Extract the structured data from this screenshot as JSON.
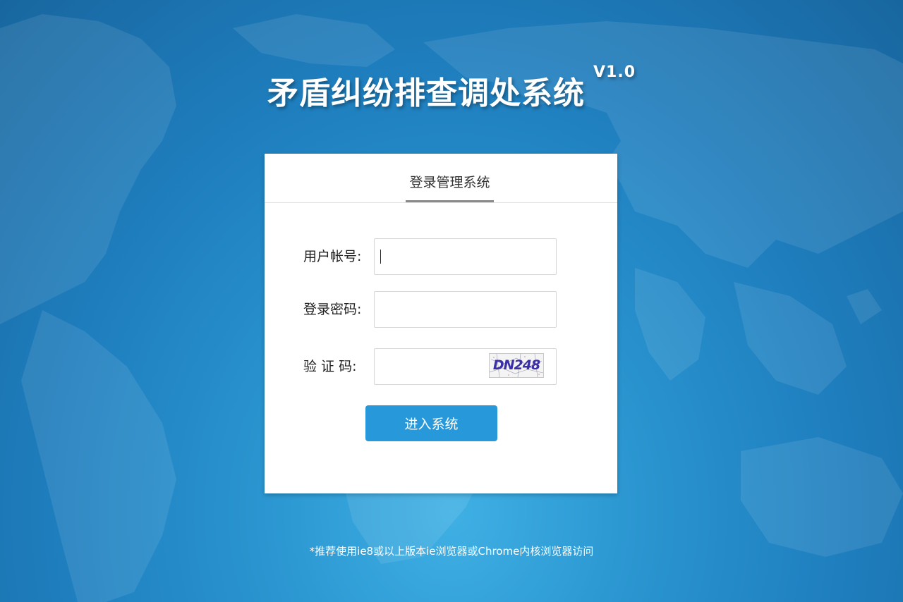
{
  "header": {
    "title": "矛盾纠纷排查调处系统",
    "version": "V1.0"
  },
  "login": {
    "tab_label": "登录管理系统",
    "username_label": "用户帐号:",
    "username_value": "",
    "password_label": "登录密码:",
    "password_value": "",
    "captcha_label": "验 证 码:",
    "captcha_value": "",
    "captcha_image_text": "DN248",
    "submit_label": "进入系统"
  },
  "footer": {
    "note": "*推荐使用ie8或以上版本ie浏览器或Chrome内核浏览器访问"
  },
  "colors": {
    "background": "#2a95d0",
    "button": "#2799da",
    "card": "#ffffff"
  }
}
